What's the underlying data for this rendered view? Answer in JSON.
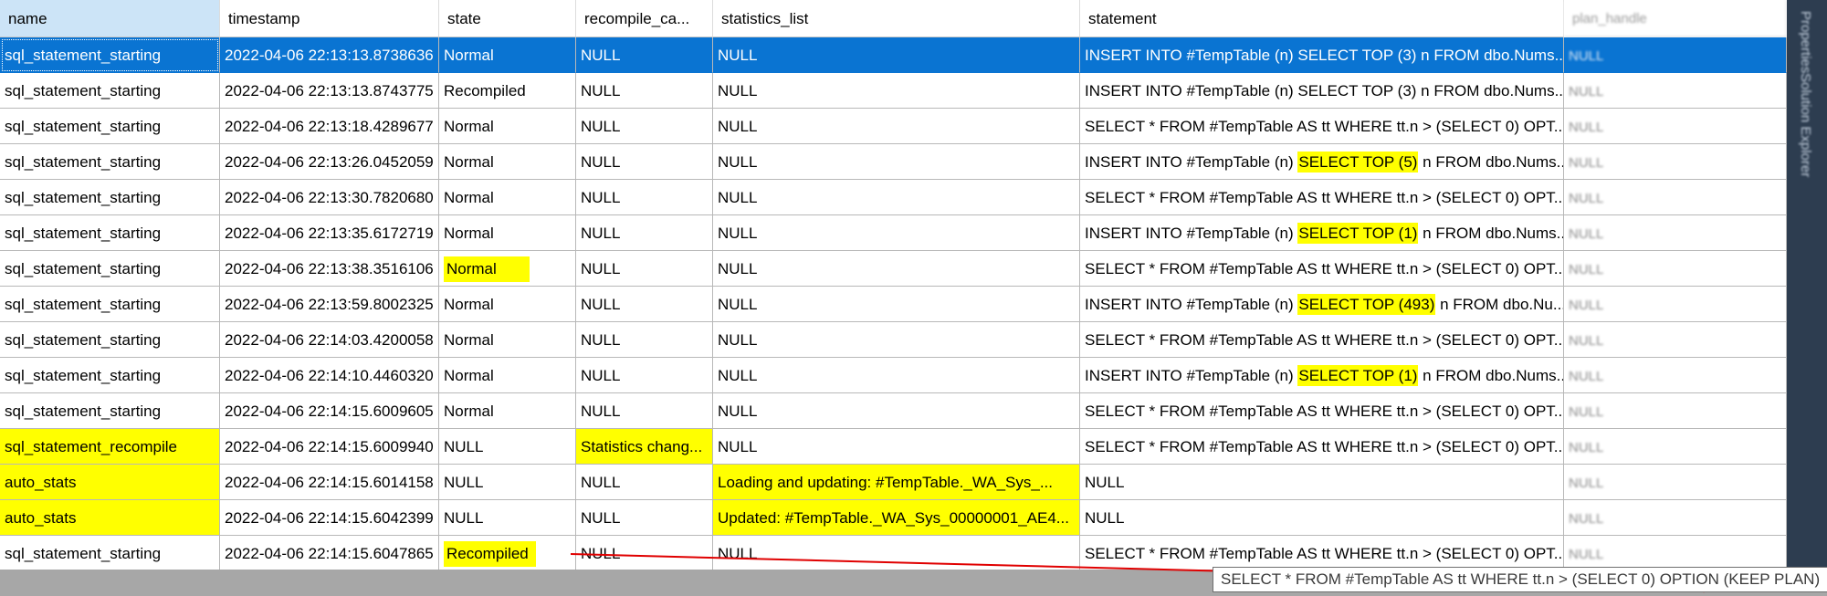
{
  "columns": [
    {
      "label": "name",
      "blurred": false
    },
    {
      "label": "timestamp",
      "blurred": false
    },
    {
      "label": "state",
      "blurred": false
    },
    {
      "label": "recompile_ca...",
      "blurred": false
    },
    {
      "label": "statistics_list",
      "blurred": false
    },
    {
      "label": "statement",
      "blurred": false
    },
    {
      "label": "plan_handle",
      "blurred": true
    }
  ],
  "rows": [
    {
      "selected": true,
      "name": "sql_statement_starting",
      "timestamp": "2022-04-06 22:13:13.8738636",
      "state": "Normal",
      "recompile_cause": "NULL",
      "statistics_list": "NULL",
      "statement": "INSERT INTO #TempTable (n)  SELECT TOP (3) n FROM dbo.Nums...",
      "plan_handle": "NULL"
    },
    {
      "name": "sql_statement_starting",
      "timestamp": "2022-04-06 22:13:13.8743775",
      "state": "Recompiled",
      "recompile_cause": "NULL",
      "statistics_list": "NULL",
      "statement": "INSERT INTO #TempTable (n)  SELECT TOP (3) n FROM dbo.Nums...",
      "plan_handle": "NULL"
    },
    {
      "name": "sql_statement_starting",
      "timestamp": "2022-04-06 22:13:18.4289677",
      "state": "Normal",
      "recompile_cause": "NULL",
      "statistics_list": "NULL",
      "statement": "SELECT * FROM  #TempTable AS tt  WHERE tt.n > (SELECT 0)  OPT...",
      "plan_handle": "NULL"
    },
    {
      "name": "sql_statement_starting",
      "timestamp": "2022-04-06 22:13:26.0452059",
      "state": "Normal",
      "recompile_cause": "NULL",
      "statistics_list": "NULL",
      "statement_pre": "INSERT INTO #TempTable (n) ",
      "statement_hl": "SELECT TOP (5)",
      "statement_post": " n FROM dbo.Nums...",
      "plan_handle": "NULL"
    },
    {
      "name": "sql_statement_starting",
      "timestamp": "2022-04-06 22:13:30.7820680",
      "state": "Normal",
      "recompile_cause": "NULL",
      "statistics_list": "NULL",
      "statement": "SELECT * FROM  #TempTable AS tt  WHERE tt.n > (SELECT 0)  OPT...",
      "plan_handle": "NULL"
    },
    {
      "name": "sql_statement_starting",
      "timestamp": "2022-04-06 22:13:35.6172719",
      "state": "Normal",
      "recompile_cause": "NULL",
      "statistics_list": "NULL",
      "statement_pre": "INSERT INTO #TempTable (n) ",
      "statement_hl": "SELECT TOP (1)",
      "statement_post": " n FROM dbo.Nums...",
      "plan_handle": "NULL"
    },
    {
      "name": "sql_statement_starting",
      "timestamp": "2022-04-06 22:13:38.3516106",
      "state": "Normal",
      "hl_state": true,
      "recompile_cause": "NULL",
      "statistics_list": "NULL",
      "statement": "SELECT * FROM  #TempTable AS tt  WHERE tt.n > (SELECT 0)  OPT...",
      "plan_handle": "NULL"
    },
    {
      "name": "sql_statement_starting",
      "timestamp": "2022-04-06 22:13:59.8002325",
      "state": "Normal",
      "recompile_cause": "NULL",
      "statistics_list": "NULL",
      "statement_pre": "INSERT INTO #TempTable (n) ",
      "statement_hl": "SELECT TOP (493)",
      "statement_post": " n FROM dbo.Nu...",
      "plan_handle": "NULL"
    },
    {
      "name": "sql_statement_starting",
      "timestamp": "2022-04-06 22:14:03.4200058",
      "state": "Normal",
      "recompile_cause": "NULL",
      "statistics_list": "NULL",
      "statement": "SELECT * FROM  #TempTable AS tt  WHERE tt.n > (SELECT 0)  OPT...",
      "plan_handle": "NULL"
    },
    {
      "name": "sql_statement_starting",
      "timestamp": "2022-04-06 22:14:10.4460320",
      "state": "Normal",
      "recompile_cause": "NULL",
      "statistics_list": "NULL",
      "statement_pre": "INSERT INTO #TempTable (n) ",
      "statement_hl": "SELECT TOP (1)",
      "statement_post": " n FROM dbo.Nums...",
      "plan_handle": "NULL"
    },
    {
      "name": "sql_statement_starting",
      "timestamp": "2022-04-06 22:14:15.6009605",
      "state": "Normal",
      "recompile_cause": "NULL",
      "statistics_list": "NULL",
      "statement": "SELECT * FROM  #TempTable AS tt  WHERE tt.n > (SELECT 0)  OPT...",
      "plan_handle": "NULL"
    },
    {
      "name": "sql_statement_recompile",
      "hl_name": true,
      "timestamp": "2022-04-06 22:14:15.6009940",
      "state": "NULL",
      "recompile_cause": "Statistics chang...",
      "hl_recompile": true,
      "statistics_list": "NULL",
      "statement": "SELECT * FROM  #TempTable AS tt  WHERE tt.n > (SELECT 0)  OPT...",
      "plan_handle": "NULL"
    },
    {
      "name": "auto_stats",
      "hl_name": true,
      "timestamp": "2022-04-06 22:14:15.6014158",
      "state": "NULL",
      "recompile_cause": "NULL",
      "statistics_list": "Loading and updating: #TempTable._WA_Sys_...",
      "hl_stats": true,
      "statement": "NULL",
      "plan_handle": "NULL"
    },
    {
      "name": "auto_stats",
      "hl_name": true,
      "timestamp": "2022-04-06 22:14:15.6042399",
      "state": "NULL",
      "recompile_cause": "NULL",
      "statistics_list": "Updated: #TempTable._WA_Sys_00000001_AE4...",
      "hl_stats": true,
      "statement": "NULL",
      "plan_handle": "NULL"
    },
    {
      "name": "sql_statement_starting",
      "timestamp": "2022-04-06 22:14:15.6047865",
      "state": "Recompiled",
      "hl_state": true,
      "recompile_cause": "NULL",
      "statistics_list": "NULL",
      "statement": "SELECT * FROM  #TempTable AS tt  WHERE tt.n > (SELECT 0)  OPT...",
      "plan_handle": "NULL"
    }
  ],
  "tooltip": "SELECT * FROM   #TempTable AS tt  WHERE tt.n > (SELECT 0)  OPTION (KEEP PLAN)",
  "side_panel": [
    "Properties",
    "Solution Explorer"
  ],
  "colors": {
    "selection": "#0a74d2",
    "highlight": "#ffff00",
    "arrow": "#e00000",
    "panel": "#2d3d50"
  }
}
